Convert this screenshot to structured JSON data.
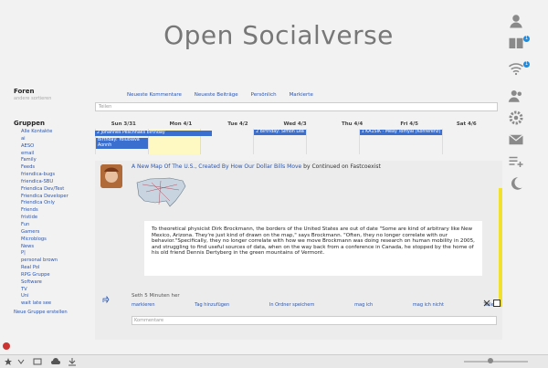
{
  "site": {
    "title": "Open Socialverse"
  },
  "right_nav": {
    "notification_badge": "1",
    "network_badge": "1"
  },
  "sidebar": {
    "forums_heading": "Foren",
    "forums_sub": "andere sortieren",
    "groups_heading": "Gruppen",
    "groups": [
      "Alle Kontakte",
      "ai",
      "AESO",
      "email",
      "Family",
      "Feeds",
      "friendica-bugs",
      "friendica-SBU",
      "Friendica Dev/Test",
      "Friendica Developer",
      "Friendica Only",
      "Friends",
      "fristide",
      "Fun",
      "Gamers",
      "Microblogs",
      "News",
      "P|",
      "personal brown",
      "Real Pol",
      "RPG Gruppe",
      "Software",
      "TV",
      "Uni",
      "wait late see"
    ],
    "new_group": "Neue Gruppe erstellen"
  },
  "tabs": [
    "Neueste Kommentare",
    "Neueste Beiträge",
    "Persönlich",
    "Markierte"
  ],
  "search": {
    "placeholder": "Teilen"
  },
  "calendar": {
    "days": [
      "Sun 3/31",
      "Mon 4/1",
      "Tue 4/2",
      "Wed 4/3",
      "Thu 4/4",
      "Fri 4/5",
      "Sat 4/6"
    ],
    "events": {
      "multi": "2 Johannes Peschnaks birthday",
      "sun": "Birthday: Yoluolava Aonnh",
      "wed": "2 Birthday: Simon Lea",
      "fri": "1 KA1SIK - Meay Tomyal (Konferenz)"
    }
  },
  "post": {
    "title_link": "A New Map Of The U.S., Created By How Our Dollar Bills Move",
    "title_suffix": " by Continued on Fastcoexist",
    "quote": "To theoretical physicist Dirk Brockmann, the borders of the United States are out of date \"Some are kind of arbitrary like New Mexico, Arizona. They're just kind of drawn on the map,\" says Brockmann. \"Often, they no longer correlate with our behavior.\"Specifically, they no longer correlate with how we move Brockmann was doing research on human mobility in 2005, and struggling to find useful sources of data, when on the way back from a conference in Canada, he stopped by the home of his old friend Dennis Dertyberg in the green mountains of Vermont.",
    "meta": "Seth 5 Minuten her",
    "actions": [
      "markieren",
      "Tag hinzufügen",
      "In Ordner speichern",
      "mag ich",
      "mag ich nicht",
      "Teilen"
    ],
    "comment_placeholder": "Kommentare"
  },
  "colors": {
    "link": "#2a55b0",
    "event": "#3a6fd0",
    "accent_yellow": "#f1e02e",
    "badge": "#1e8de0"
  },
  "icons": [
    "user-icon",
    "book-icon",
    "wifi-icon",
    "contacts-icon",
    "gear-icon",
    "mail-icon",
    "playlist-add-icon",
    "moon-icon"
  ]
}
